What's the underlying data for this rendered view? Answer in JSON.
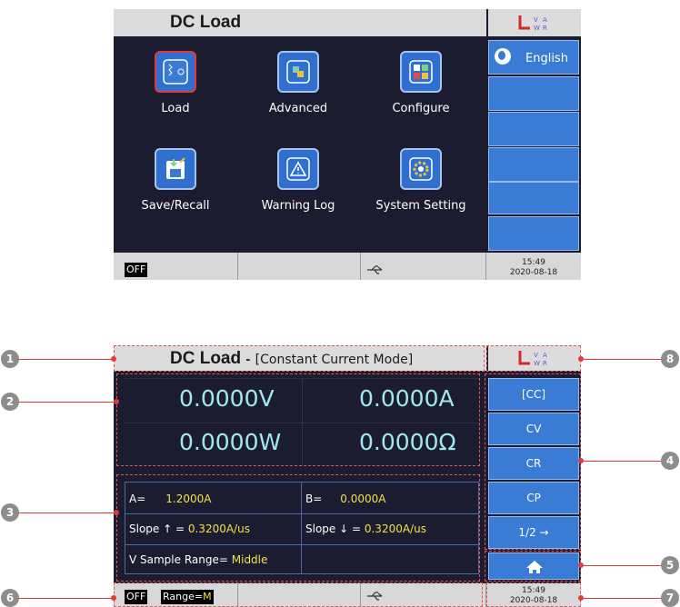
{
  "screen1": {
    "title": "DC Load",
    "language_button": "English",
    "apps": [
      {
        "label": "Load",
        "icon": "load-icon"
      },
      {
        "label": "Advanced",
        "icon": "advanced-icon"
      },
      {
        "label": "Configure",
        "icon": "configure-icon"
      },
      {
        "label": "Save/Recall",
        "icon": "save-recall-icon"
      },
      {
        "label": "Warning Log",
        "icon": "warning-icon"
      },
      {
        "label": "System Setting",
        "icon": "gear-icon"
      }
    ],
    "status": {
      "off": "OFF",
      "time": "15:49",
      "date": "2020-08-18"
    }
  },
  "screen2": {
    "title": "DC Load",
    "title_sep": "-",
    "mode": "[Constant Current Mode]",
    "readings": {
      "voltage": "0.0000V",
      "current": "0.0000A",
      "power": "0.0000W",
      "resistance": "0.0000Ω"
    },
    "params": {
      "a_label": "A=",
      "a_value": "1.2000A",
      "b_label": "B=",
      "b_value": "0.0000A",
      "slope_up_label": "Slope ↑ =",
      "slope_up_value": "0.3200A/us",
      "slope_down_label": "Slope ↓ =",
      "slope_down_value": "0.3200A/us",
      "vrange_label": "V Sample Range=",
      "vrange_value": "Middle"
    },
    "side_buttons": [
      "[CC]",
      "CV",
      "CR",
      "CP",
      "1/2 →"
    ],
    "status": {
      "off": "OFF",
      "range_label": "Range=",
      "range_value": "M",
      "time": "15:49",
      "date": "2020-08-18"
    }
  },
  "callouts": [
    "1",
    "2",
    "3",
    "4",
    "5",
    "6",
    "7",
    "8"
  ],
  "colors": {
    "screen_bg": "#1c1c30",
    "button_blue": "#3a7bd5",
    "readout": "#9ee8f4",
    "value_yellow": "#f2e14a",
    "callout_red": "#e03a3a"
  }
}
